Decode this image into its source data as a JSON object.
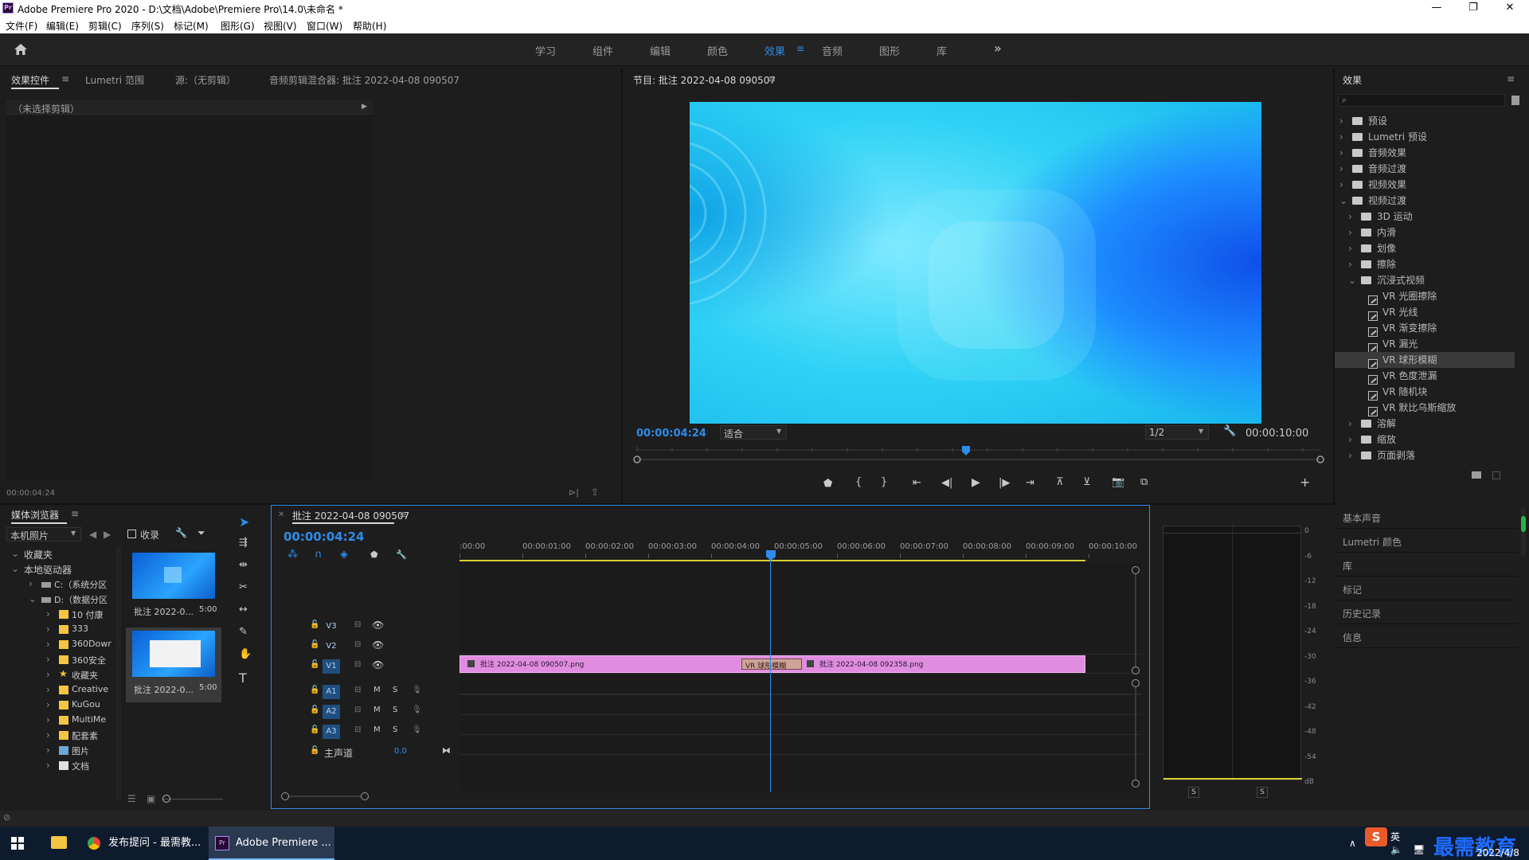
{
  "window": {
    "title": "Adobe Premiere Pro 2020 - D:\\文档\\Adobe\\Premiere Pro\\14.0\\未命名 *",
    "app_icon": "Pr",
    "controls": [
      "—",
      "❐",
      "✕"
    ]
  },
  "menu": [
    "文件(F)",
    "编辑(E)",
    "剪辑(C)",
    "序列(S)",
    "标记(M)",
    "图形(G)",
    "视图(V)",
    "窗口(W)",
    "帮助(H)"
  ],
  "workspaces": {
    "items": [
      "学习",
      "组件",
      "编辑",
      "颜色",
      "效果",
      "音频",
      "图形",
      "库"
    ],
    "active": "效果",
    "more": "»"
  },
  "source_panel": {
    "tabs": [
      "效果控件",
      "Lumetri 范围",
      "源:（无剪辑）",
      "音频剪辑混合器: 批注 2022-04-08 090507"
    ],
    "no_clip": "（未选择剪辑）",
    "timecode": "00:00:04:24"
  },
  "program": {
    "title": "节目: 批注 2022-04-08 090507",
    "timecode": "00:00:04:24",
    "fit": "适合",
    "resolution": "1/2",
    "duration": "00:00:10:00"
  },
  "effects_panel": {
    "title": "效果",
    "search_placeholder": "",
    "tree": [
      {
        "label": "预设",
        "level": 0,
        "kind": "folder-preset",
        "expanded": false
      },
      {
        "label": "Lumetri 预设",
        "level": 0,
        "kind": "folder-preset",
        "expanded": false
      },
      {
        "label": "音频效果",
        "level": 0,
        "kind": "folder",
        "expanded": false
      },
      {
        "label": "音频过渡",
        "level": 0,
        "kind": "folder",
        "expanded": false
      },
      {
        "label": "视频效果",
        "level": 0,
        "kind": "folder",
        "expanded": false
      },
      {
        "label": "视频过渡",
        "level": 0,
        "kind": "folder",
        "expanded": true
      },
      {
        "label": "3D 运动",
        "level": 1,
        "kind": "folder",
        "expanded": false
      },
      {
        "label": "内滑",
        "level": 1,
        "kind": "folder",
        "expanded": false
      },
      {
        "label": "划像",
        "level": 1,
        "kind": "folder",
        "expanded": false
      },
      {
        "label": "擦除",
        "level": 1,
        "kind": "folder",
        "expanded": false
      },
      {
        "label": "沉浸式视频",
        "level": 1,
        "kind": "folder",
        "expanded": true
      },
      {
        "label": "VR 光圈擦除",
        "level": 2,
        "kind": "effect"
      },
      {
        "label": "VR 光线",
        "level": 2,
        "kind": "effect"
      },
      {
        "label": "VR 渐变擦除",
        "level": 2,
        "kind": "effect"
      },
      {
        "label": "VR 漏光",
        "level": 2,
        "kind": "effect"
      },
      {
        "label": "VR 球形模糊",
        "level": 2,
        "kind": "effect",
        "selected": true
      },
      {
        "label": "VR 色度泄漏",
        "level": 2,
        "kind": "effect"
      },
      {
        "label": "VR 随机块",
        "level": 2,
        "kind": "effect"
      },
      {
        "label": "VR 默比乌斯缩放",
        "level": 2,
        "kind": "effect"
      },
      {
        "label": "溶解",
        "level": 1,
        "kind": "folder",
        "expanded": false
      },
      {
        "label": "缩放",
        "level": 1,
        "kind": "folder",
        "expanded": false
      },
      {
        "label": "页面剥落",
        "level": 1,
        "kind": "folder",
        "expanded": false
      }
    ],
    "side_panels": [
      "基本声音",
      "Lumetri 颜色",
      "库",
      "标记",
      "历史记录",
      "信息"
    ]
  },
  "media_browser": {
    "title": "媒体浏览器",
    "location": "本机照片",
    "favorites_label": "收录",
    "tree": [
      {
        "label": "收藏夹",
        "level": 0,
        "expanded": true,
        "kind": "none"
      },
      {
        "label": "本地驱动器",
        "level": 0,
        "expanded": true,
        "kind": "none"
      },
      {
        "label": "C:（系统分区",
        "level": 1,
        "kind": "drive"
      },
      {
        "label": "D:（数据分区",
        "level": 1,
        "kind": "drive",
        "expanded": true
      },
      {
        "label": "10 付康",
        "level": 2,
        "kind": "folder"
      },
      {
        "label": "333",
        "level": 2,
        "kind": "folder"
      },
      {
        "label": "360Dowr",
        "level": 2,
        "kind": "folder"
      },
      {
        "label": "360安全",
        "level": 2,
        "kind": "folder"
      },
      {
        "label": "收藏夹",
        "level": 2,
        "kind": "star"
      },
      {
        "label": "Creative",
        "level": 2,
        "kind": "folder"
      },
      {
        "label": "KuGou",
        "level": 2,
        "kind": "folder"
      },
      {
        "label": "MultiMe",
        "level": 2,
        "kind": "folder"
      },
      {
        "label": "配套素",
        "level": 2,
        "kind": "folder"
      },
      {
        "label": "图片",
        "level": 2,
        "kind": "pic"
      },
      {
        "label": "文档",
        "level": 2,
        "kind": "doc"
      }
    ],
    "thumbs": [
      {
        "label": "批注 2022-0...",
        "duration": "5:00"
      },
      {
        "label": "批注 2022-0...",
        "duration": "5:00"
      }
    ]
  },
  "timeline": {
    "tab": "批注 2022-04-08 090507",
    "timecode": "00:00:04:24",
    "ruler": [
      ":00:00",
      "00:00:01:00",
      "00:00:02:00",
      "00:00:03:00",
      "00:00:04:00",
      "00:00:05:00",
      "00:00:06:00",
      "00:00:07:00",
      "00:00:08:00",
      "00:00:09:00",
      "00:00:10:00",
      "0"
    ],
    "video_tracks": [
      "V3",
      "V2",
      "V1"
    ],
    "audio_tracks": [
      "A1",
      "A2",
      "A3"
    ],
    "master": "主声道",
    "master_value": "0.0",
    "mute": "M",
    "solo": "S",
    "clips": [
      {
        "label": "批注 2022-04-08 090507.png"
      },
      {
        "label": "批注 2022-04-08 092358.png"
      }
    ],
    "transition": "VR 球形模糊"
  },
  "meter": {
    "scale": [
      "0",
      "-6",
      "-12",
      "-18",
      "-24",
      "-30",
      "-36",
      "-42",
      "-48",
      "-54",
      "dB"
    ],
    "solo_left": "S",
    "solo_right": "S"
  },
  "taskbar": {
    "apps": [
      "发布提问 - 最需教...",
      "Adobe Premiere ..."
    ],
    "tray_ime": "英",
    "date": "2022/4/8",
    "watermark": "最需教育"
  },
  "colors": {
    "accent": "#2d8ceb",
    "clip": "#e08de0",
    "workarea": "#d8cf34",
    "preview_a": "#1cc8f0",
    "preview_b": "#19a3ff"
  }
}
